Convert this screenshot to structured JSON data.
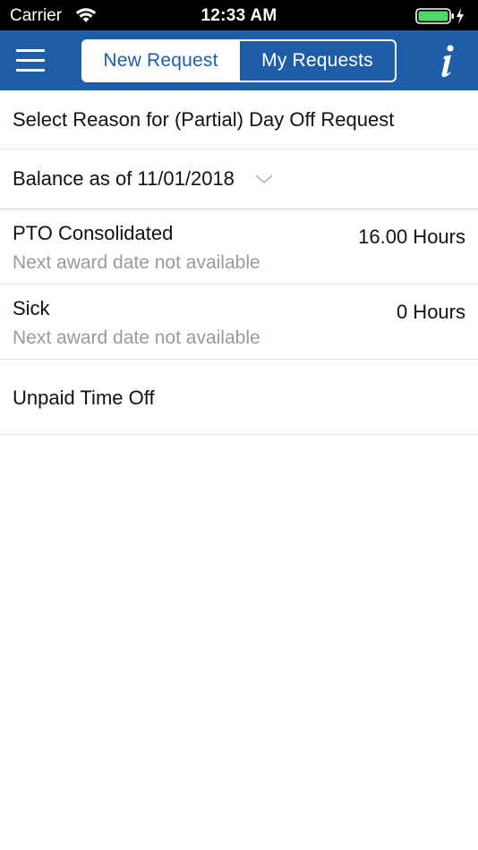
{
  "status_bar": {
    "carrier": "Carrier",
    "time": "12:33 AM",
    "wifi_icon": "wifi-icon",
    "battery_icon": "battery-charging-icon"
  },
  "nav": {
    "menu_icon": "hamburger-menu-icon",
    "tabs": [
      {
        "label": "New Request",
        "active": true
      },
      {
        "label": "My Requests",
        "active": false
      }
    ],
    "info_icon": "info-icon"
  },
  "main": {
    "reason_title": "Select Reason for (Partial) Day Off Request",
    "balance_label": "Balance as of 11/01/2018",
    "leave_types": [
      {
        "name": "PTO Consolidated",
        "hours": "16.00 Hours",
        "note": "Next award date not available"
      },
      {
        "name": "Sick",
        "hours": "0 Hours",
        "note": "Next award date not available"
      },
      {
        "name": "Unpaid Time Off",
        "hours": "",
        "note": ""
      }
    ]
  },
  "colors": {
    "brand_blue": "#1e5ea8",
    "subtext_gray": "#9a9a9a",
    "divider": "#e2e2e2"
  }
}
